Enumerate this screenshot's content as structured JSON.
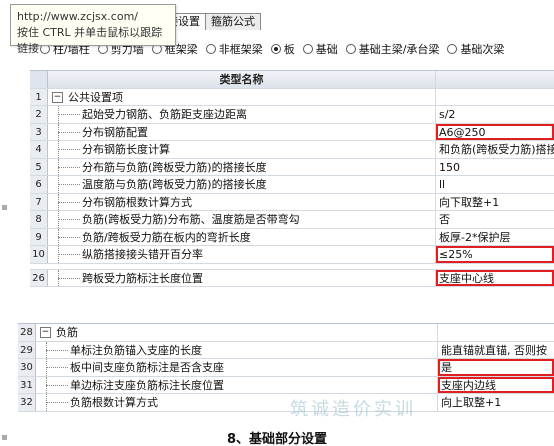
{
  "tooltip": {
    "url": "http://www.zcjsx.com/",
    "hint": "按住 CTRL 并单击鼠标以跟踪链接"
  },
  "tabs": [
    {
      "label": "搭接设置"
    },
    {
      "label": "箍筋公式"
    }
  ],
  "radios": [
    {
      "label": "柱/墙柱",
      "checked": false
    },
    {
      "label": "剪力墙",
      "checked": false
    },
    {
      "label": "框架梁",
      "checked": false
    },
    {
      "label": "非框架梁",
      "checked": false
    },
    {
      "label": "板",
      "checked": true
    },
    {
      "label": "基础",
      "checked": false
    },
    {
      "label": "基础主梁/承台梁",
      "checked": false
    },
    {
      "label": "基础次梁",
      "checked": false
    }
  ],
  "grid": {
    "header": "类型名称",
    "group1": {
      "num": "1",
      "expander": "−",
      "label": "公共设置项"
    },
    "rows": [
      {
        "num": "2",
        "name": "起始受力钢筋、负筋距支座边距离",
        "value": "s/2",
        "hl": false
      },
      {
        "num": "3",
        "name": "分布钢筋配置",
        "value": "A6@250",
        "hl": true
      },
      {
        "num": "4",
        "name": "分布钢筋长度计算",
        "value": "和负筋(跨板受力筋)搭接",
        "hl": false
      },
      {
        "num": "5",
        "name": "分布筋与负筋(跨板受力筋)的搭接长度",
        "value": "150",
        "hl": false
      },
      {
        "num": "6",
        "name": "温度筋与负筋(跨板受力筋)的搭接长度",
        "value": "ll",
        "hl": false
      },
      {
        "num": "7",
        "name": "分布钢筋根数计算方式",
        "value": "向下取整+1",
        "hl": false
      },
      {
        "num": "8",
        "name": "负筋(跨板受力筋)分布筋、温度筋是否带弯勾",
        "value": "否",
        "hl": false
      },
      {
        "num": "9",
        "name": "负筋/跨板受力筋在板内的弯折长度",
        "value": "板厚-2*保护层",
        "hl": false
      },
      {
        "num": "10",
        "name": "纵筋搭接接头错开百分率",
        "value": "≤25%",
        "hl": true
      }
    ],
    "row26": {
      "num": "26",
      "name": "跨板受力筋标注长度位置",
      "value": "支座中心线",
      "hl": true
    }
  },
  "grid2": {
    "group": {
      "num": "28",
      "expander": "−",
      "label": "负筋"
    },
    "rows": [
      {
        "num": "29",
        "name": "单标注负筋锚入支座的长度",
        "value": "能直锚就直锚, 否则按",
        "hl": false
      },
      {
        "num": "30",
        "name": "板中间支座负筋标注是否含支座",
        "value": "是",
        "hl": true
      },
      {
        "num": "31",
        "name": "单边标注支座负筋标注长度位置",
        "value": "支座内边线",
        "hl": true
      },
      {
        "num": "32",
        "name": "负筋根数计算方式",
        "value": "向上取整+1",
        "hl": false
      }
    ]
  },
  "watermark": "筑诚造价实训",
  "caption": "8、基础部分设置",
  "colors": {
    "highlight": "#e02020",
    "header_bg": "#dde3eb"
  }
}
